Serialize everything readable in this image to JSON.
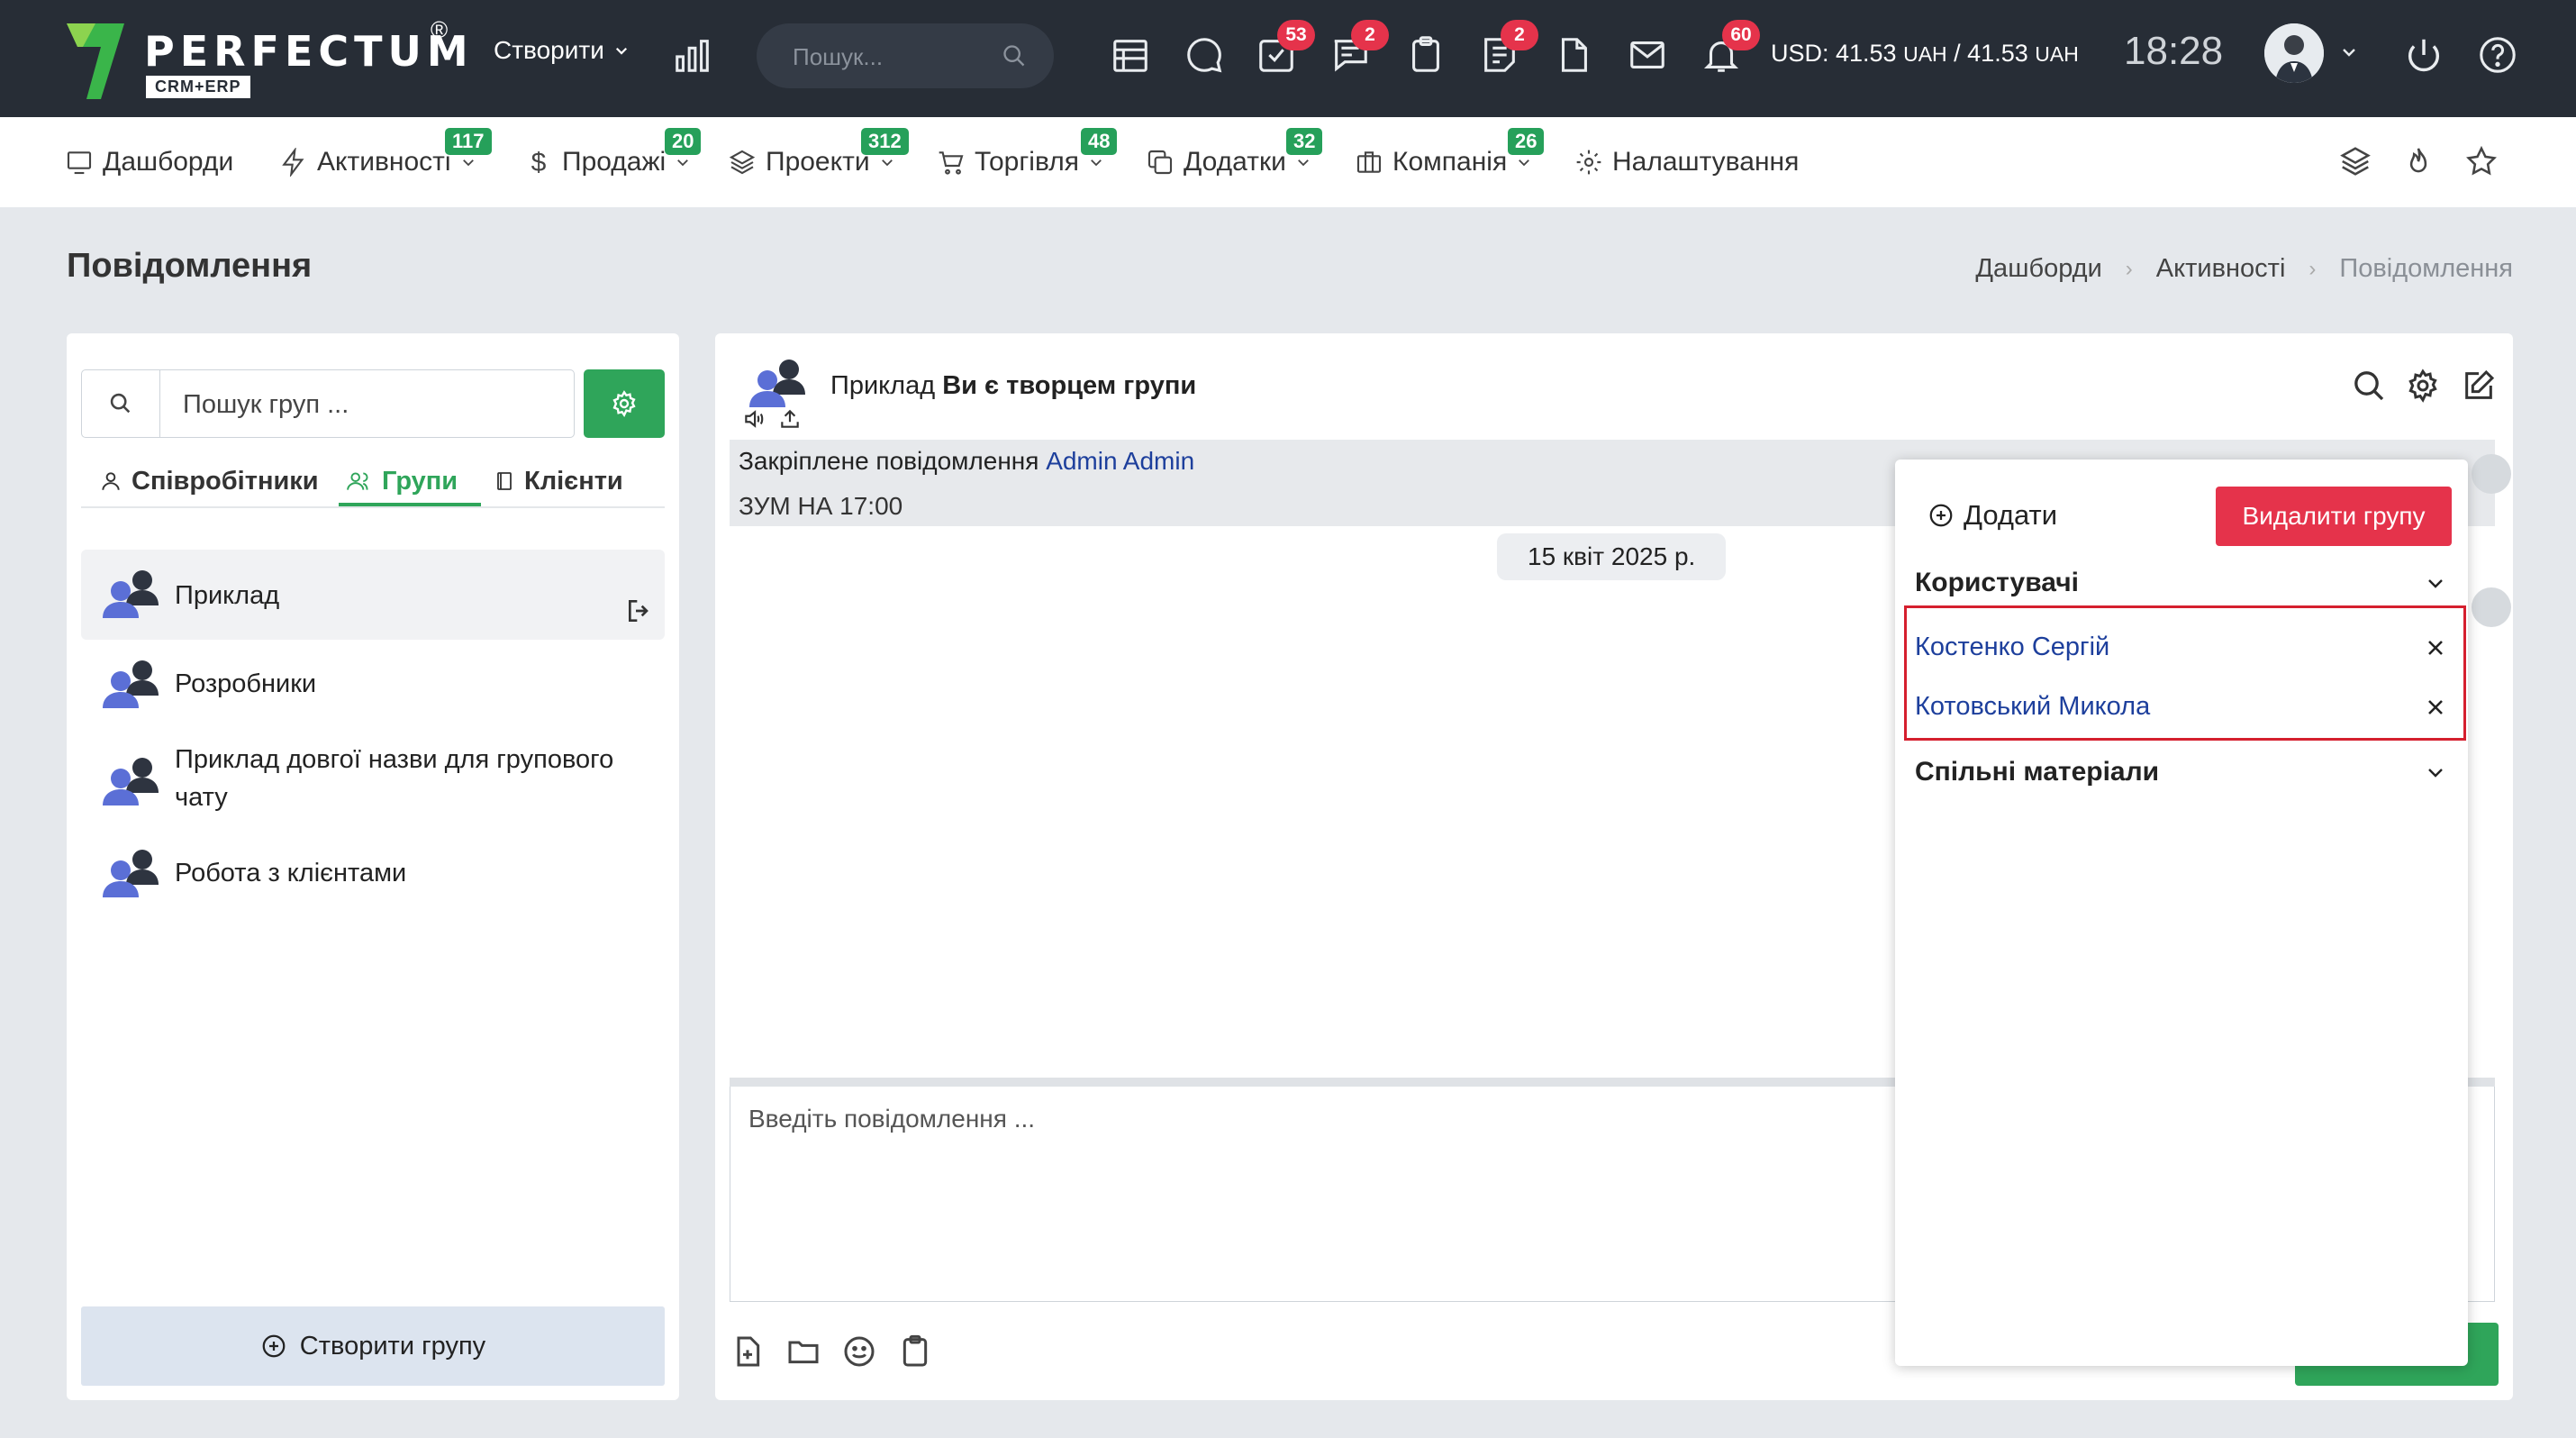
{
  "topbar": {
    "logo_text": "PERFECTUM",
    "logo_reg": "®",
    "logo_sub": "CRM+ERP",
    "create_label": "Створити",
    "search_placeholder": "Пошук...",
    "badges": {
      "tasks": "53",
      "chat": "2",
      "notes": "2",
      "mail": "60"
    },
    "currency": {
      "prefix": "USD: 41.53",
      "unit1": "UAH",
      "mid": " / 41.53",
      "unit2": "UAH"
    },
    "clock": "18:28"
  },
  "nav": {
    "dashboards": "Дашборди",
    "activities": "Активності",
    "activities_badge": "117",
    "sales": "Продажі",
    "sales_badge": "20",
    "projects": "Проекти",
    "projects_badge": "312",
    "trade": "Торгівля",
    "trade_badge": "48",
    "addons": "Додатки",
    "addons_badge": "32",
    "company": "Компанія",
    "company_badge": "26",
    "settings": "Налаштування"
  },
  "page": {
    "title": "Повідомлення",
    "breadcrumbs": [
      "Дашборди",
      "Активності",
      "Повідомлення"
    ]
  },
  "left": {
    "search_placeholder": "Пошук груп ...",
    "tabs": [
      "Співробітники",
      "Групи",
      "Клієнти"
    ],
    "groups": [
      "Приклад",
      "Розробники",
      "Приклад довгої назви для групового чату",
      "Робота з клієнтами"
    ],
    "create_group": "Створити групу"
  },
  "chat": {
    "group_name": "Приклад",
    "creator_note": "Ви є творцем групи",
    "pinned_label": "Закріплене повідомлення",
    "pinned_author": "Admin Admin",
    "pinned_text": "ЗУМ НА 17:00",
    "date": "15 квіт 2025 р.",
    "input_placeholder": "Введіть повідомлення ..."
  },
  "popover": {
    "add_label": "Додати",
    "delete_label": "Видалити групу",
    "users_title": "Користувачі",
    "users": [
      "Костенко Сергій",
      "Котовський Микола"
    ],
    "shared_title": "Спільні матеріали"
  },
  "colors": {
    "topbar": "#272d36",
    "accent_green": "#2fa55a",
    "danger_red": "#e5334b",
    "link_blue": "#1d3f9c",
    "highlight_red": "#d51f2e"
  }
}
